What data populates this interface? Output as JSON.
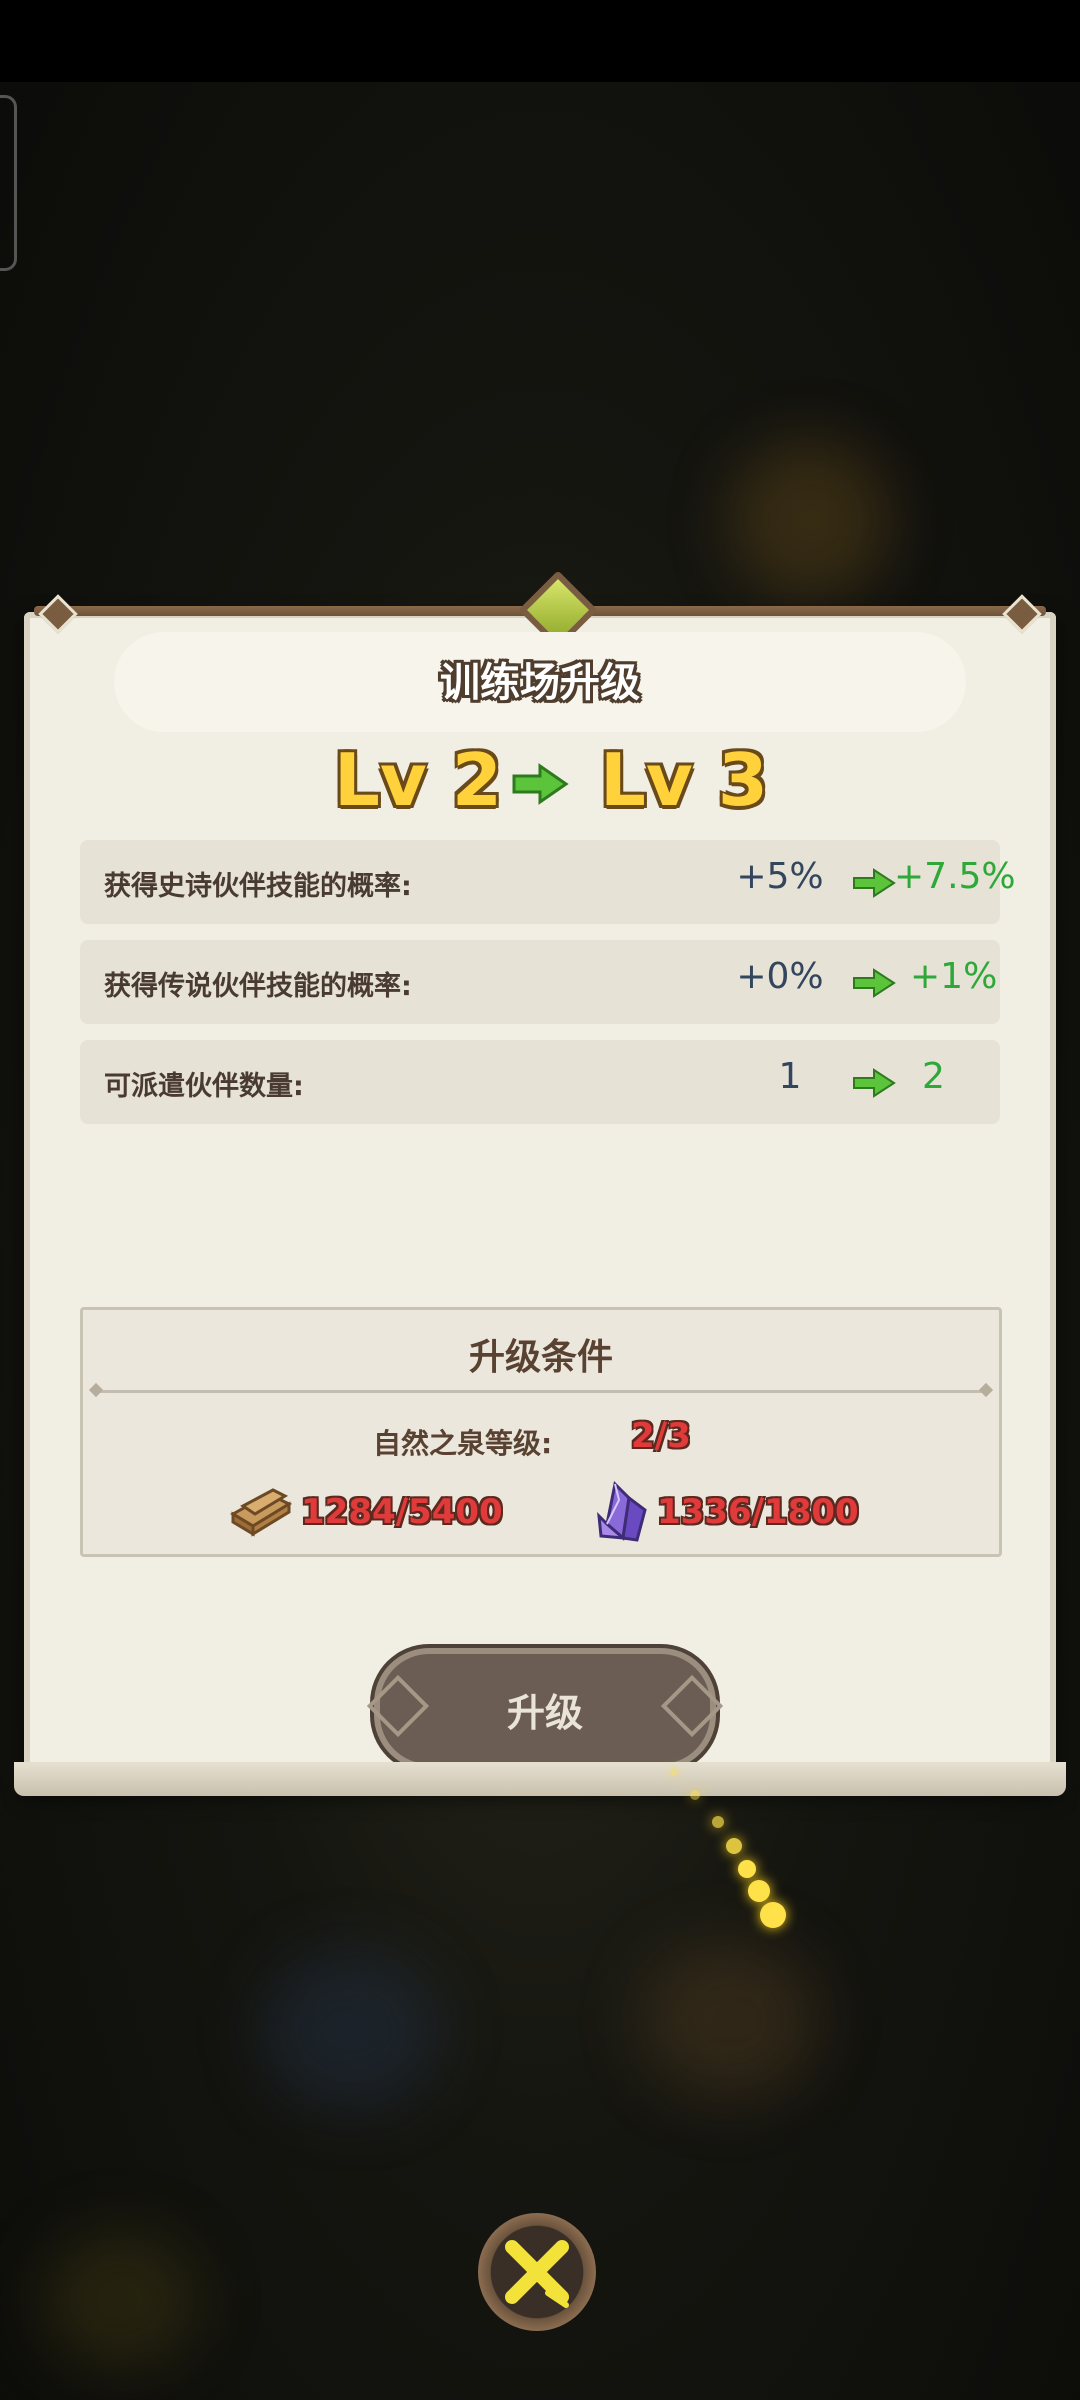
{
  "dialog": {
    "title": "训练场升级",
    "level_from": "Lv 2",
    "level_to": "Lv 3",
    "stats": [
      {
        "label": "获得史诗伙伴技能的概率:",
        "old": "+5%",
        "new": "+7.5%"
      },
      {
        "label": "获得传说伙伴技能的概率:",
        "old": "+0%",
        "new": "+1%"
      },
      {
        "label": "可派遣伙伴数量:",
        "old": "1",
        "new": "2"
      }
    ],
    "conditions": {
      "title": "升级条件",
      "requirement_label": "自然之泉等级:",
      "requirement_value": "2/3",
      "resources": [
        {
          "icon": "wood-planks-icon",
          "value": "1284/5400"
        },
        {
          "icon": "purple-crystal-icon",
          "value": "1336/1800"
        }
      ]
    },
    "upgrade_button": "升级"
  },
  "colors": {
    "level_gold": "#ffd23c",
    "arrow_green": "#5cc43a",
    "new_value_green": "#2fa83a",
    "insufficient_red": "#e03a3a",
    "close_x_yellow": "#f2e23a"
  }
}
